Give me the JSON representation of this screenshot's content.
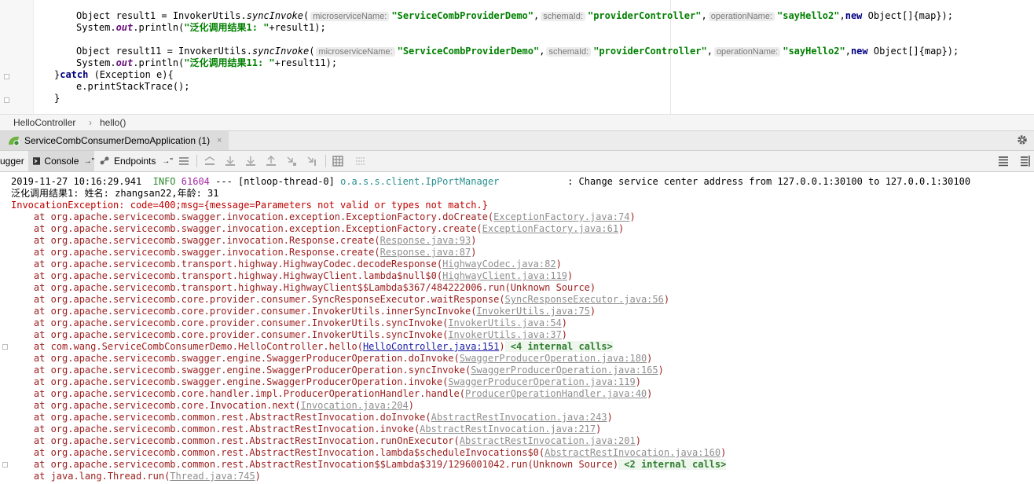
{
  "editor": {
    "line1": {
      "a": "Object result1 = InvokerUtils.",
      "method": "syncInvoke",
      "b": "(",
      "hint1": "microserviceName:",
      "s1": "\"ServiceCombProviderDemo\"",
      "c1": ",",
      "hint2": "schemaId:",
      "s2": "\"providerController\"",
      "c2": ",",
      "hint3": "operationName:",
      "s3": "\"sayHello2\"",
      "c3": ",",
      "kw": "new",
      "d": " Object[]{map});"
    },
    "line2": {
      "a": "System.",
      "fld": "out",
      "b": ".println(",
      "s": "\"泛化调用结果1: \"",
      "c": "+result1);"
    },
    "line3": {
      "a": "Object result11 = InvokerUtils.",
      "method": "syncInvoke",
      "b": "(",
      "hint1": "microserviceName:",
      "s1": "\"ServiceCombProviderDemo\"",
      "c1": ",",
      "hint2": "schemaId:",
      "s2": "\"providerController\"",
      "c2": ",",
      "hint3": "operationName:",
      "s3": "\"sayHello2\"",
      "c3": ",",
      "kw": "new",
      "d": " Object[]{map});"
    },
    "line4": {
      "a": "System.",
      "fld": "out",
      "b": ".println(",
      "s": "\"泛化调用结果11: \"",
      "c": "+result11);"
    },
    "line5": {
      "a": "}",
      "kw": "catch",
      "b": " (Exception e){"
    },
    "line6": {
      "a": "e.printStackTrace();"
    },
    "line7": {
      "a": "}"
    }
  },
  "breadcrumb": {
    "class": "HelloController",
    "method": "hello()",
    "separator": "›"
  },
  "run_tab": {
    "label": "ServiceCombConsumerDemoApplication (1)",
    "close": "×"
  },
  "toolbar": {
    "debugger": "ugger",
    "console": "Console",
    "console_arrow": "→\"",
    "endpoints": "Endpoints",
    "endpoints_arrow": "→\""
  },
  "console": {
    "log": {
      "ts": "2019-11-27 10:16:29.941",
      "level": "INFO",
      "pid": "61604",
      "sep": "---",
      "thread": "[ntloop-thread-0]",
      "logger": "o.a.s.s.client.IpPortManager",
      "msg": "           : Change service center address from 127.0.0.1:30100 to 127.0.0.1:30100"
    },
    "result_line": "泛化调用结果1: 姓名: zhangsan22,年龄: 31",
    "exception_line": "InvocationException: code=400;msg={message=Parameters not valid or types not match.}",
    "frames": [
      {
        "m": "org.apache.servicecomb.swagger.invocation.exception.ExceptionFactory.doCreate",
        "f": "ExceptionFactory.java:74"
      },
      {
        "m": "org.apache.servicecomb.swagger.invocation.exception.ExceptionFactory.create",
        "f": "ExceptionFactory.java:61"
      },
      {
        "m": "org.apache.servicecomb.swagger.invocation.Response.create",
        "f": "Response.java:93"
      },
      {
        "m": "org.apache.servicecomb.swagger.invocation.Response.create",
        "f": "Response.java:87"
      },
      {
        "m": "org.apache.servicecomb.transport.highway.HighwayCodec.decodeResponse",
        "f": "HighwayCodec.java:82"
      },
      {
        "m": "org.apache.servicecomb.transport.highway.HighwayClient.lambda$null$0",
        "f": "HighwayClient.java:119"
      },
      {
        "m": "org.apache.servicecomb.transport.highway.HighwayClient$$Lambda$367/484222006.run",
        "f": "Unknown Source",
        "plain": true
      },
      {
        "m": "org.apache.servicecomb.core.provider.consumer.SyncResponseExecutor.waitResponse",
        "f": "SyncResponseExecutor.java:56"
      },
      {
        "m": "org.apache.servicecomb.core.provider.consumer.InvokerUtils.innerSyncInvoke",
        "f": "InvokerUtils.java:75"
      },
      {
        "m": "org.apache.servicecomb.core.provider.consumer.InvokerUtils.syncInvoke",
        "f": "InvokerUtils.java:54"
      },
      {
        "m": "org.apache.servicecomb.core.provider.consumer.InvokerUtils.syncInvoke",
        "f": "InvokerUtils.java:37"
      },
      {
        "m": "com.wang.ServiceCombConsumerDemo.HelloController.hello",
        "f": "HelloController.java:151",
        "user": true,
        "extra": "<4 internal calls>"
      },
      {
        "m": "org.apache.servicecomb.swagger.engine.SwaggerProducerOperation.doInvoke",
        "f": "SwaggerProducerOperation.java:180"
      },
      {
        "m": "org.apache.servicecomb.swagger.engine.SwaggerProducerOperation.syncInvoke",
        "f": "SwaggerProducerOperation.java:165"
      },
      {
        "m": "org.apache.servicecomb.swagger.engine.SwaggerProducerOperation.invoke",
        "f": "SwaggerProducerOperation.java:119"
      },
      {
        "m": "org.apache.servicecomb.core.handler.impl.ProducerOperationHandler.handle",
        "f": "ProducerOperationHandler.java:40"
      },
      {
        "m": "org.apache.servicecomb.core.Invocation.next",
        "f": "Invocation.java:204"
      },
      {
        "m": "org.apache.servicecomb.common.rest.AbstractRestInvocation.doInvoke",
        "f": "AbstractRestInvocation.java:243"
      },
      {
        "m": "org.apache.servicecomb.common.rest.AbstractRestInvocation.invoke",
        "f": "AbstractRestInvocation.java:217"
      },
      {
        "m": "org.apache.servicecomb.common.rest.AbstractRestInvocation.runOnExecutor",
        "f": "AbstractRestInvocation.java:201"
      },
      {
        "m": "org.apache.servicecomb.common.rest.AbstractRestInvocation.lambda$scheduleInvocations$0",
        "f": "AbstractRestInvocation.java:160"
      },
      {
        "m": "org.apache.servicecomb.common.rest.AbstractRestInvocation$$Lambda$319/1296001042.run",
        "f": "Unknown Source",
        "plain": true,
        "extra": "<2 internal calls>"
      },
      {
        "m": "java.lang.Thread.run",
        "f": "Thread.java:745"
      }
    ]
  },
  "colors": {
    "keyword": "#000080",
    "string": "#008000",
    "error": "#c00000",
    "link": "#1a1aa6",
    "info": "#2b8a2b"
  },
  "icons": [
    "spring-boot-icon",
    "close-icon",
    "console-icon",
    "endpoints-icon",
    "menu-icon",
    "restore-layout-icon",
    "step-over-icon",
    "step-into-icon",
    "force-step-into-icon",
    "step-out-icon",
    "drop-frame-icon",
    "run-to-cursor-icon",
    "evaluate-icon",
    "soft-wrap-icon",
    "scroll-to-end-icon",
    "gear-icon"
  ]
}
